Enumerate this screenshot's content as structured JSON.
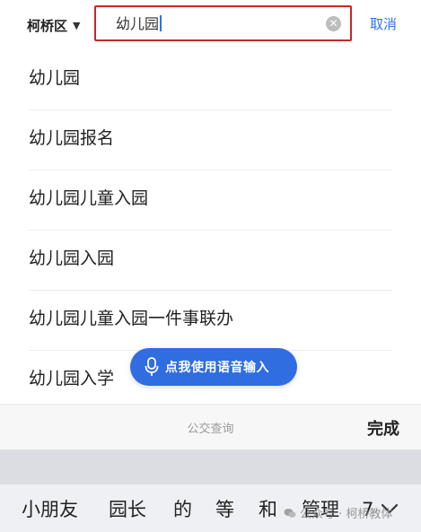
{
  "search_bar": {
    "district_label": "柯桥区",
    "query": "幼儿园",
    "cancel_label": "取消"
  },
  "suggestions": [
    "幼儿园",
    "幼儿园报名",
    "幼儿园儿童入园",
    "幼儿园入园",
    "幼儿园儿童入园一件事联办",
    "幼儿园入学"
  ],
  "voice_button": {
    "label": "点我使用语音输入"
  },
  "keyboard": {
    "toolbar_hint": "公交查询",
    "done_label": "完成",
    "candidates": [
      "小朋友",
      "园长",
      "的",
      "等",
      "和",
      "管理",
      "7"
    ]
  },
  "watermark": "公众号 · 柯桥教体",
  "colors": {
    "accent_blue": "#2a73e8",
    "voice_button_blue": "#2f6de0",
    "search_border_red": "#c8262b"
  }
}
